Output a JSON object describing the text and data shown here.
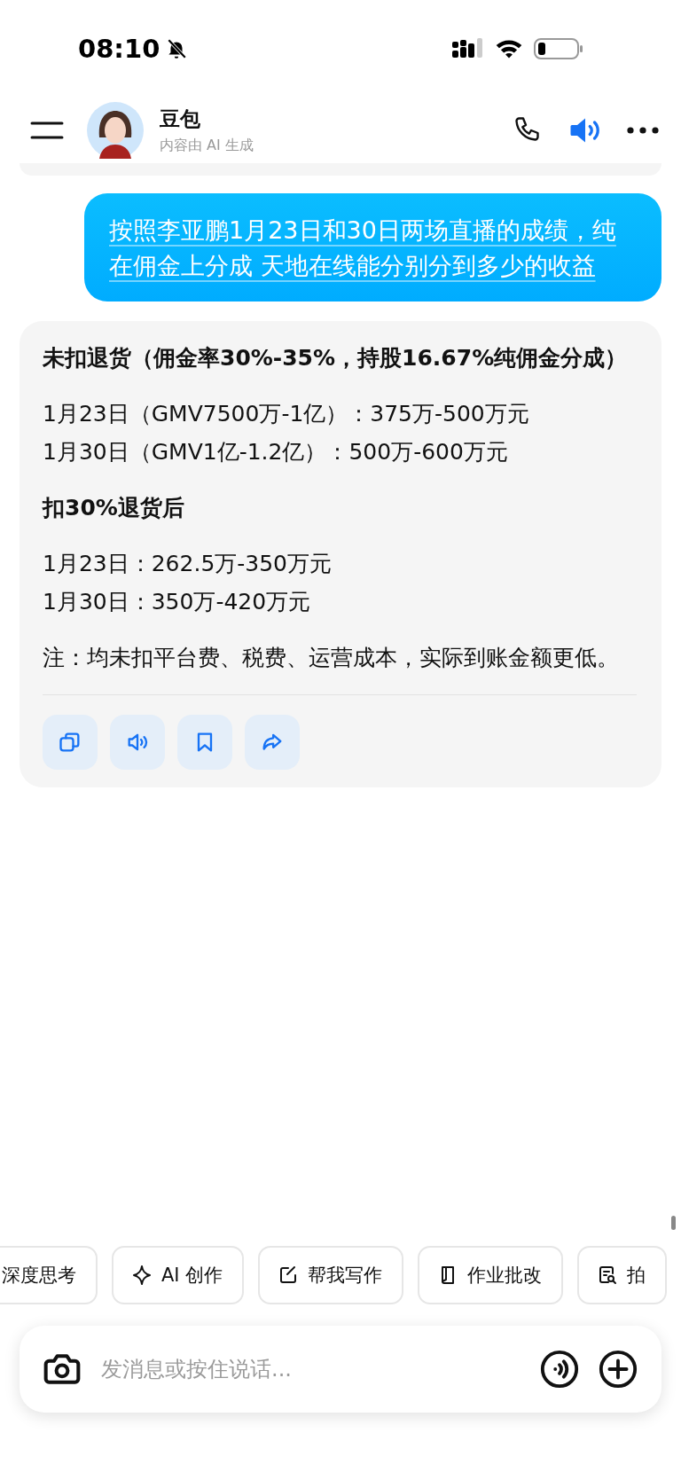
{
  "status_bar": {
    "time": "08:10"
  },
  "header": {
    "name": "豆包",
    "subtitle": "内容由 AI 生成"
  },
  "user_message": {
    "text": "按照李亚鹏1月23日和30日两场直播的成绩，纯在佣金上分成 天地在线能分别分到多少的收益"
  },
  "answer": {
    "blocks": [
      {
        "kind": "heading",
        "lines": [
          "未扣退货（佣金率30%-35%，持股16.67%纯佣金分成）"
        ]
      },
      {
        "kind": "text",
        "lines": [
          "1月23日（GMV7500万-1亿）：375万-500万元",
          "1月30日（GMV1亿-1.2亿）：500万-600万元"
        ]
      },
      {
        "kind": "heading",
        "lines": [
          "扣30%退货后"
        ]
      },
      {
        "kind": "text",
        "lines": [
          "1月23日：262.5万-350万元",
          "1月30日：350万-420万元"
        ]
      },
      {
        "kind": "text",
        "lines": [
          "注：均未扣平台费、税费、运营成本，实际到账金额更低。"
        ]
      }
    ],
    "actions": [
      {
        "kind": "copy"
      },
      {
        "kind": "speaker"
      },
      {
        "kind": "bookmark"
      },
      {
        "kind": "share"
      }
    ]
  },
  "shortcuts": [
    {
      "kind": "none",
      "label": "深度思考"
    },
    {
      "kind": "sparkle",
      "label": "AI 创作"
    },
    {
      "kind": "edit",
      "label": "帮我写作"
    },
    {
      "kind": "book",
      "label": "作业批改"
    },
    {
      "kind": "scan",
      "label": "拍"
    }
  ],
  "composer": {
    "placeholder": "发消息或按住说话..."
  }
}
